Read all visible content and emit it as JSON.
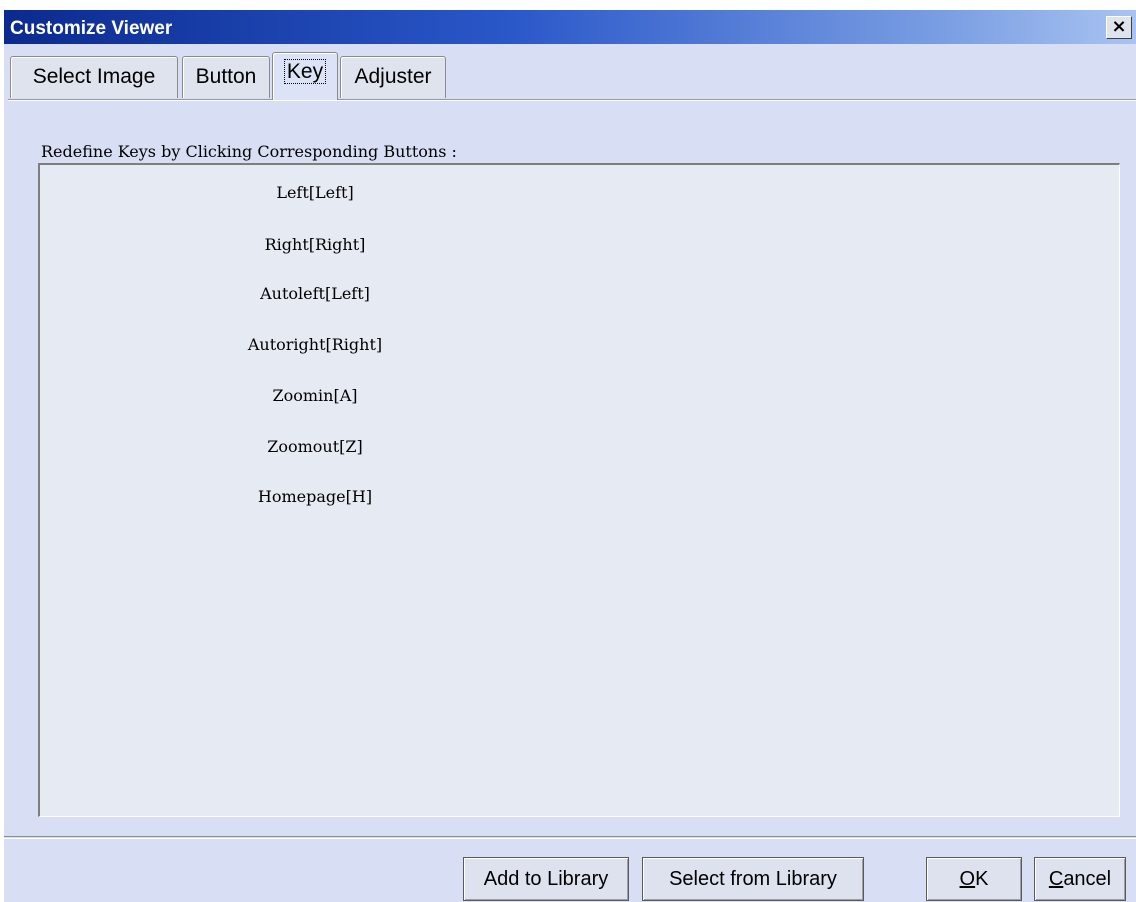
{
  "window": {
    "title": "Customize Viewer",
    "close_symbol": "×"
  },
  "tabs": [
    {
      "label": "Select Image",
      "active": false
    },
    {
      "label": "Button",
      "active": false
    },
    {
      "label": "Key",
      "active": true
    },
    {
      "label": "Adjuster",
      "active": false
    }
  ],
  "key_panel": {
    "instruction": "Redefine Keys by Clicking Corresponding Buttons :",
    "items": [
      "Left[Left]",
      "Right[Right]",
      "Autoleft[Left]",
      "Autoright[Right]",
      "Zoomin[A]",
      "Zoomout[Z]",
      "Homepage[H]"
    ]
  },
  "footer": {
    "add_library": "Add to Library",
    "select_library": "Select from Library",
    "ok_mnemonic": "O",
    "ok_rest": "K",
    "cancel_mnemonic": "C",
    "cancel_rest": "ancel"
  },
  "colors": {
    "titlebar_start": "#0b2a8f",
    "titlebar_end": "#a9c3f2",
    "dialog_background": "#d8dff5"
  }
}
